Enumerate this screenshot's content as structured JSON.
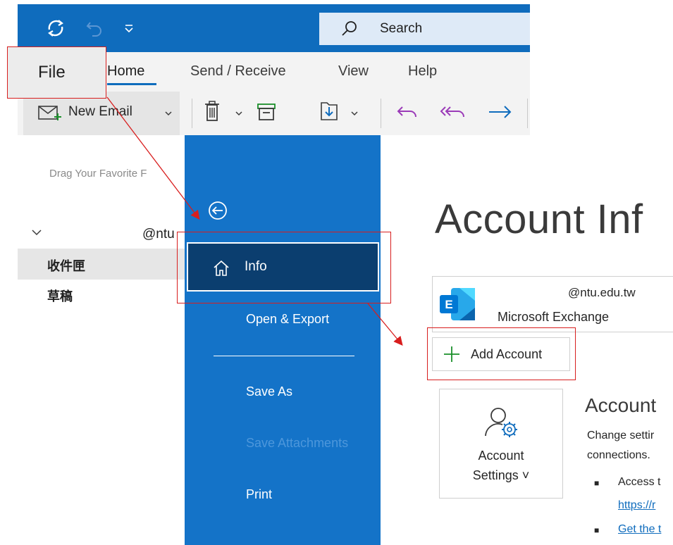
{
  "window": {
    "search_placeholder": "Search"
  },
  "ribbon": {
    "tabs": [
      {
        "label": "File"
      },
      {
        "label": "Home"
      },
      {
        "label": "Send / Receive"
      },
      {
        "label": "View"
      },
      {
        "label": "Help"
      }
    ],
    "new_email_label": "New Email"
  },
  "folder_pane": {
    "favorites_hint": "Drag Your Favorite F",
    "account_label": "@ntu",
    "folders": [
      {
        "label": "收件匣"
      },
      {
        "label": "草稿"
      }
    ]
  },
  "backstage": {
    "nav": [
      {
        "label": "Info"
      },
      {
        "label": "Open & Export"
      },
      {
        "label": "Save As"
      },
      {
        "label": "Save Attachments"
      },
      {
        "label": "Print"
      }
    ],
    "title": "Account Inf",
    "account_email": "@ntu.edu.tw",
    "account_type": "Microsoft Exchange",
    "add_account_label": "Add Account",
    "settings_button": {
      "line1": "Account",
      "line2": "Settings ˅"
    },
    "section_heading": "Account",
    "section_desc_line1": "Change settir",
    "section_desc_line2": "connections.",
    "bullets": [
      {
        "text": "Access t"
      },
      {
        "text": "https://r"
      },
      {
        "text": "Get the t"
      }
    ]
  },
  "colors": {
    "title_bar": "#0f6cbd",
    "backstage_nav": "#1473c8",
    "nav_selected": "#0b3e6f",
    "annotation": "#d81e1e",
    "link": "#0f6cbd"
  }
}
